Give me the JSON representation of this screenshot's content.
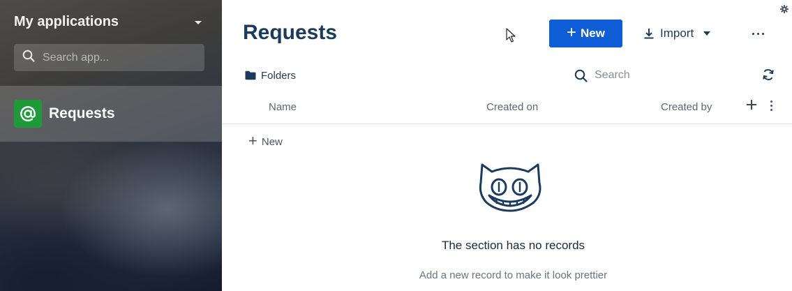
{
  "sidebar": {
    "header": "My applications",
    "search_placeholder": "Search app...",
    "items": [
      {
        "label": "Requests",
        "icon": "at-sign-icon",
        "active": true
      }
    ]
  },
  "main": {
    "title": "Requests",
    "new_button": "New",
    "import_button": "Import",
    "folders_label": "Folders",
    "search_placeholder": "Search",
    "columns": [
      "Name",
      "Created on",
      "Created by"
    ],
    "add_row_label": "New",
    "empty_title": "The section has no records",
    "empty_subtitle": "Add a new record to make it look prettier"
  },
  "colors": {
    "primary": "#0f5ed8",
    "title": "#1c3b5c",
    "app_icon": "#1f9a3a"
  }
}
